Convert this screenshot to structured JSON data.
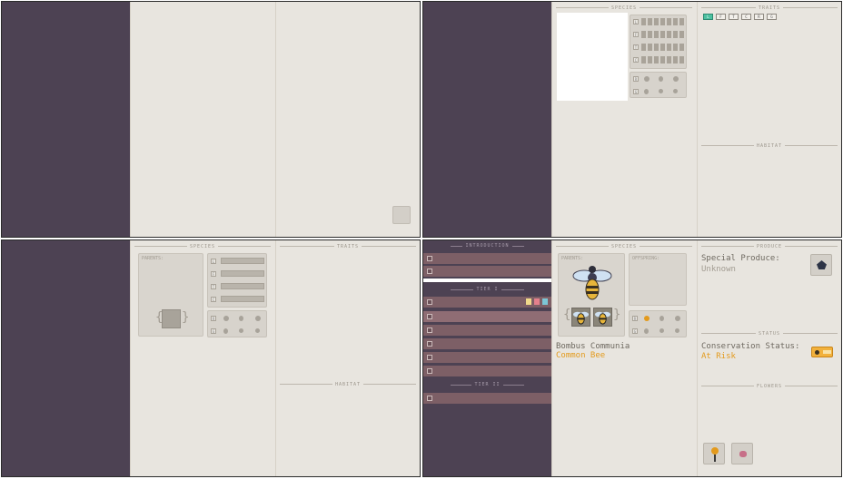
{
  "panels": {
    "tr": {
      "species_header": "SPECIES",
      "traits_header": "TRAITS",
      "habitat_header": "HABITAT",
      "gene_rows": [
        "L",
        "F",
        "T",
        "C"
      ],
      "icon_rows": [
        "R",
        "G"
      ],
      "trait_tabs": [
        "L",
        "F",
        "T",
        "C",
        "R",
        "G"
      ]
    },
    "bl": {
      "species_header": "SPECIES",
      "traits_header": "TRAITS",
      "habitat_header": "HABITAT",
      "parents_label": "PARENTS:",
      "gene_rows": [
        "L",
        "F",
        "T",
        "C"
      ],
      "icon_rows": [
        "R",
        "G"
      ]
    },
    "br": {
      "sidebar": {
        "intro_header": "INTRODUCTION",
        "tier1_header": "TIER I",
        "tier2_header": "TIER II"
      },
      "species_header": "SPECIES",
      "parents_label": "PARENTS:",
      "offspring_label": "OFFSPRING:",
      "species_latin": "Bombus Communia",
      "species_common": "Common Bee",
      "produce_header": "PRODUCE",
      "special_produce_label": "Special Produce:",
      "special_produce_value": "Unknown",
      "status_header": "STATUS",
      "conservation_label": "Conservation Status:",
      "conservation_value": "At Risk",
      "flowers_header": "FLOWERS",
      "icon_rows": [
        "R",
        "G"
      ]
    }
  },
  "colors": {
    "sidebar": "#4d4253",
    "page": "#e8e5df",
    "accent_orange": "#e39a1c",
    "teal": "#4cc0a0",
    "row": "#7d5f66"
  }
}
